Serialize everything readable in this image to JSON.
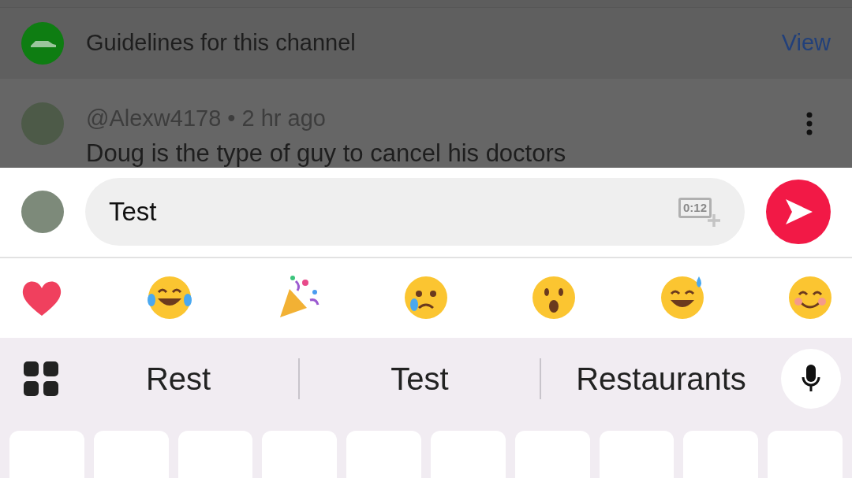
{
  "guidelines": {
    "text": "Guidelines for this channel",
    "action": "View"
  },
  "comment": {
    "author": "@Alexw4178",
    "separator": "•",
    "time": "2 hr ago",
    "text": "Doug is the type of guy to cancel his doctors"
  },
  "composer": {
    "value": "Test",
    "clip_label": "0:12"
  },
  "reactions": [
    {
      "kind": "heart"
    },
    {
      "kind": "tears-of-joy"
    },
    {
      "kind": "party-popper"
    },
    {
      "kind": "sad-tear"
    },
    {
      "kind": "surprised"
    },
    {
      "kind": "sweat-smile"
    },
    {
      "kind": "smile"
    }
  ],
  "suggestions": [
    {
      "label": "Rest"
    },
    {
      "label": "Test"
    },
    {
      "label": "Restaurants"
    }
  ]
}
